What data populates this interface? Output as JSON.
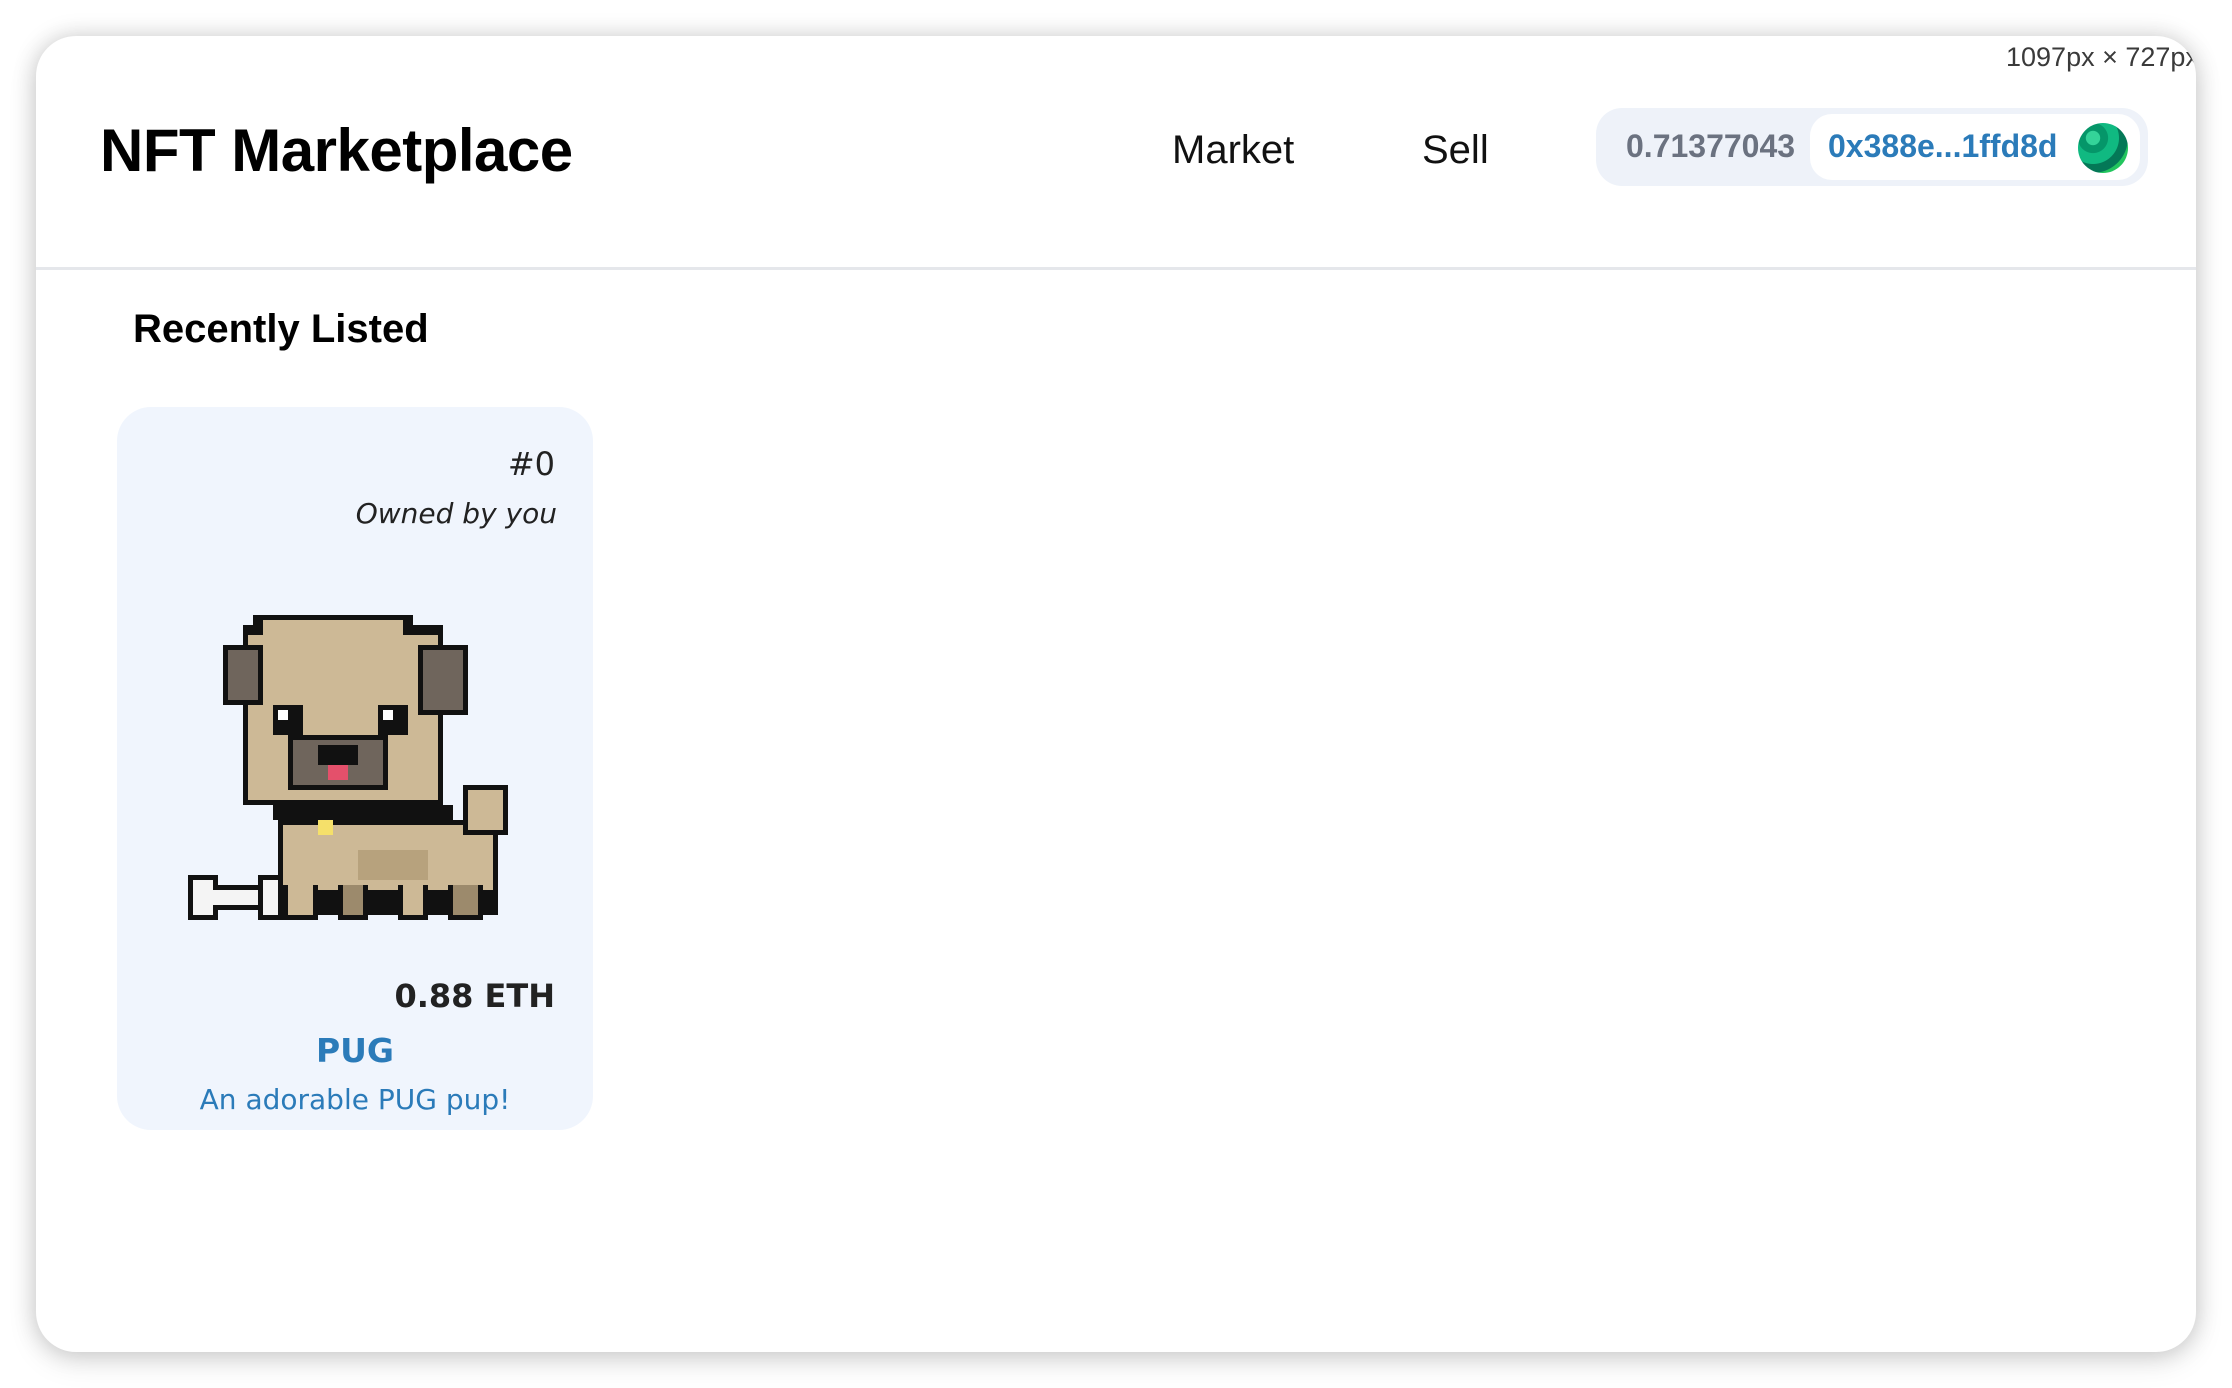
{
  "overlay": {
    "size_readout": "1097px × 727px"
  },
  "header": {
    "brand": "NFT Marketplace",
    "nav": {
      "market": "Market",
      "sell": "Sell"
    },
    "wallet": {
      "balance": "0.71377043",
      "address": "0x388e...1ffd8d",
      "avatar_icon": "wallet-avatar-icon"
    }
  },
  "main": {
    "section_title": "Recently Listed",
    "listings": [
      {
        "token_id": "#0",
        "owner_text": "Owned by you",
        "image_icon": "pug-nft-image",
        "price": "0.88 ETH",
        "name": "PUG",
        "description": "An adorable PUG pup!"
      }
    ]
  },
  "colors": {
    "accent": "#2b7bb9",
    "card_bg": "#f0f5fd",
    "wallet_bg": "#eef2f9",
    "muted": "#6b7280"
  }
}
